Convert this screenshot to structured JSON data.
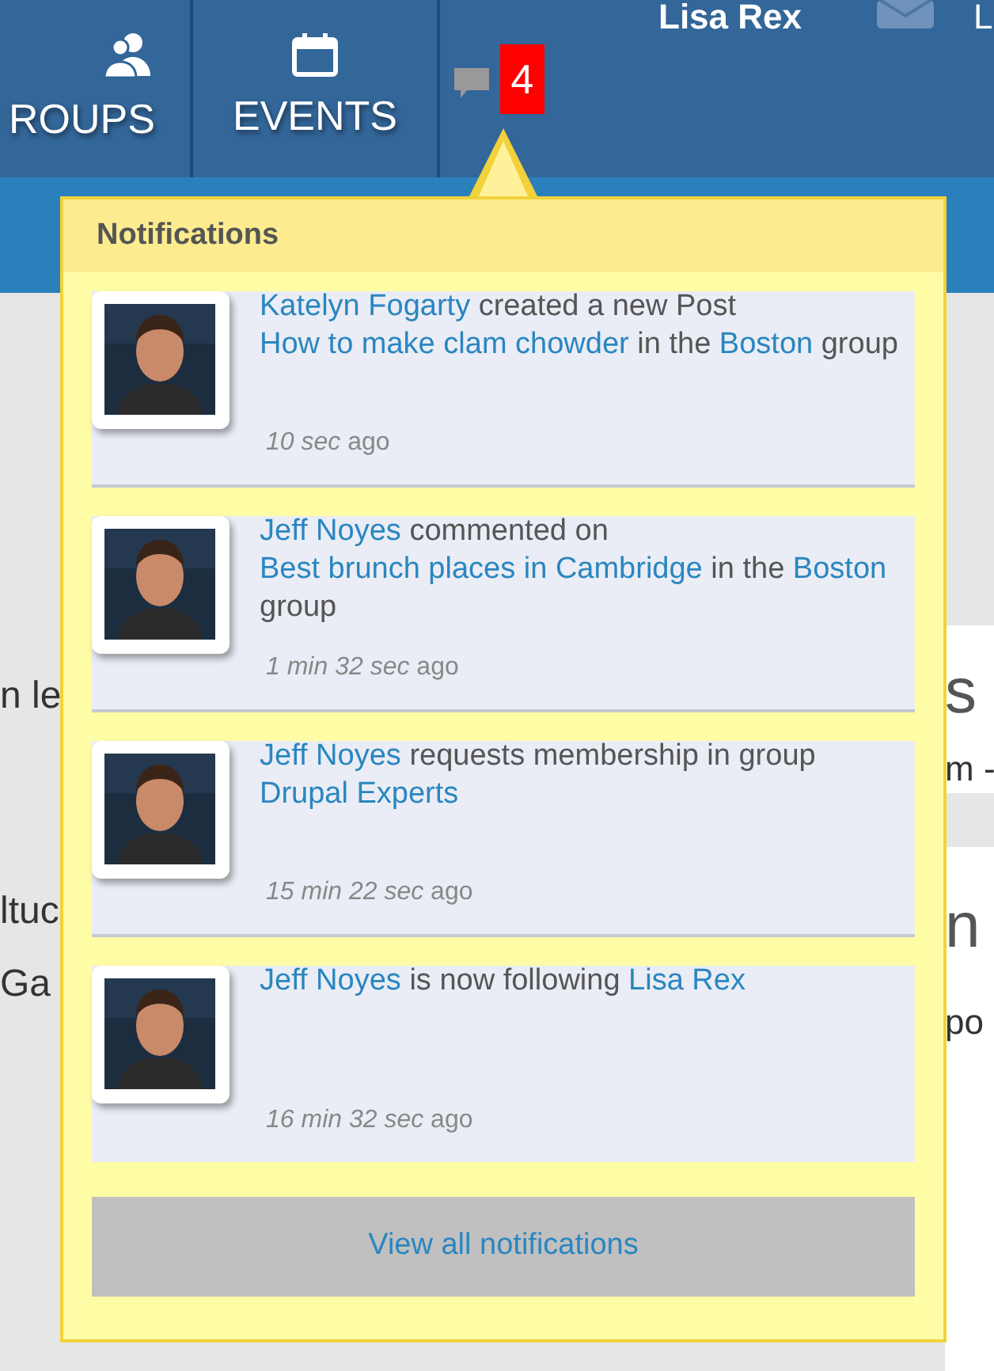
{
  "nav": {
    "items": [
      {
        "label": "ROUPS",
        "kind": "groups"
      },
      {
        "label": "EVENTS",
        "kind": "events"
      }
    ],
    "badge": "4",
    "user_name": "Lisa Rex",
    "cut_label": "L"
  },
  "background": {
    "left": [
      "n le",
      "ltuc",
      "Ga"
    ],
    "right": [
      "s",
      "m -",
      "n",
      "po"
    ]
  },
  "notifications": {
    "title": "Notifications",
    "items": [
      {
        "segments": [
          {
            "kind": "link",
            "text": "Katelyn Fogarty"
          },
          {
            "kind": "text",
            "text": " created a new Post "
          },
          {
            "kind": "link",
            "text": "How to make clam chowder"
          },
          {
            "kind": "text",
            "text": " in the "
          },
          {
            "kind": "link",
            "text": "Boston"
          },
          {
            "kind": "text",
            "text": " group"
          }
        ],
        "time": "*10 sec* ago"
      },
      {
        "segments": [
          {
            "kind": "link",
            "text": "Jeff Noyes"
          },
          {
            "kind": "text",
            "text": " commented on "
          },
          {
            "kind": "link",
            "text": "Best brunch places in Cambridge"
          },
          {
            "kind": "text",
            "text": " in the "
          },
          {
            "kind": "link",
            "text": "Boston"
          },
          {
            "kind": "text",
            "text": " group"
          }
        ],
        "time": "*1 min 32 sec* ago"
      },
      {
        "segments": [
          {
            "kind": "link",
            "text": "Jeff Noyes"
          },
          {
            "kind": "text",
            "text": " requests membership in group "
          },
          {
            "kind": "link",
            "text": "Drupal Experts"
          }
        ],
        "time": "*15 min 22 sec* ago"
      },
      {
        "segments": [
          {
            "kind": "link",
            "text": "Jeff Noyes"
          },
          {
            "kind": "text",
            "text": " is now following "
          },
          {
            "kind": "link",
            "text": "Lisa Rex"
          }
        ],
        "time": "*16 min 32 sec* ago"
      }
    ],
    "view_all": "View all notifications"
  }
}
